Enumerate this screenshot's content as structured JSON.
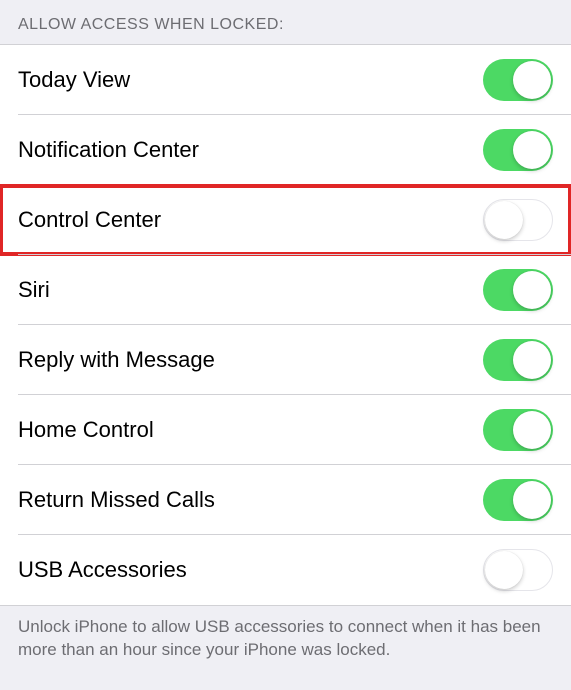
{
  "section_header": "ALLOW ACCESS WHEN LOCKED:",
  "rows": [
    {
      "label": "Today View",
      "on": true,
      "highlight": false
    },
    {
      "label": "Notification Center",
      "on": true,
      "highlight": false
    },
    {
      "label": "Control Center",
      "on": false,
      "highlight": true
    },
    {
      "label": "Siri",
      "on": true,
      "highlight": false
    },
    {
      "label": "Reply with Message",
      "on": true,
      "highlight": false
    },
    {
      "label": "Home Control",
      "on": true,
      "highlight": false
    },
    {
      "label": "Return Missed Calls",
      "on": true,
      "highlight": false
    },
    {
      "label": "USB Accessories",
      "on": false,
      "highlight": false
    }
  ],
  "section_footer": "Unlock iPhone to allow USB accessories to connect when it has been more than an hour since your iPhone was locked."
}
